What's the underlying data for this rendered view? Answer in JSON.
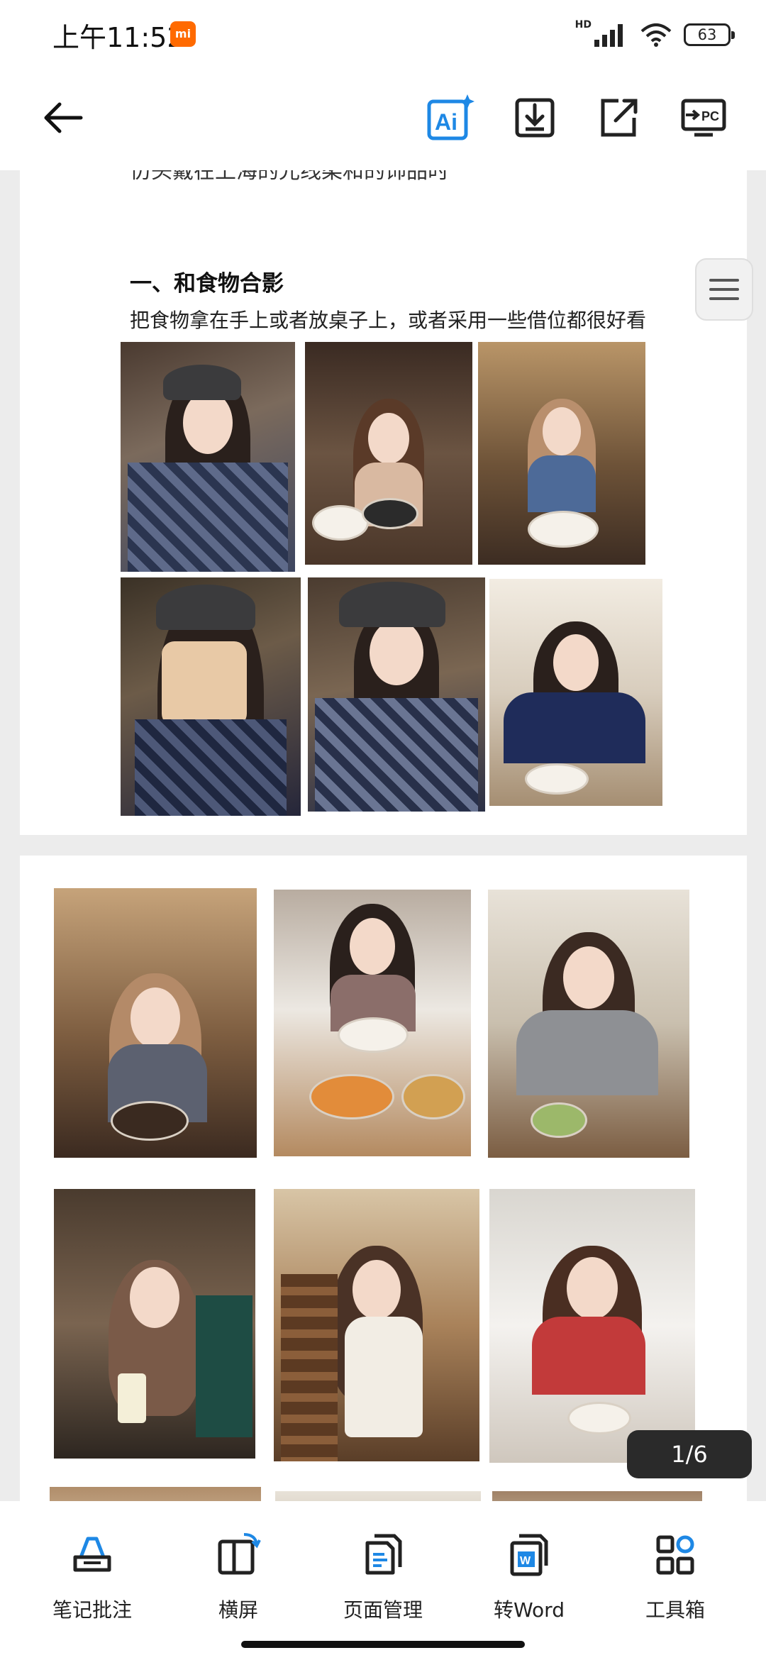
{
  "status_bar": {
    "time": "上午11:52",
    "mi_badge": "mi",
    "network": "HD",
    "battery": "63"
  },
  "toolbar": {
    "icons": [
      "back-arrow-icon",
      "ai-icon",
      "download-icon",
      "share-icon",
      "pc-cast-icon"
    ],
    "pc_label": "PC",
    "ai_label": "Ai",
    "accent_color": "#1e88e5"
  },
  "document": {
    "clipped_line": "仿头戴在上海的光线柔和的饰品时",
    "section_heading": "一、和食物合影",
    "section_text": "把食物拿在手上或者放桌子上，或者采用一些借位都很好看"
  },
  "page_indicator": "1/6",
  "bottom_nav": [
    {
      "label": "笔记批注",
      "icon": "annotate-icon"
    },
    {
      "label": "横屏",
      "icon": "rotate-screen-icon"
    },
    {
      "label": "页面管理",
      "icon": "page-manage-icon"
    },
    {
      "label": "转Word",
      "icon": "word-convert-icon"
    },
    {
      "label": "工具箱",
      "icon": "toolbox-icon"
    }
  ]
}
